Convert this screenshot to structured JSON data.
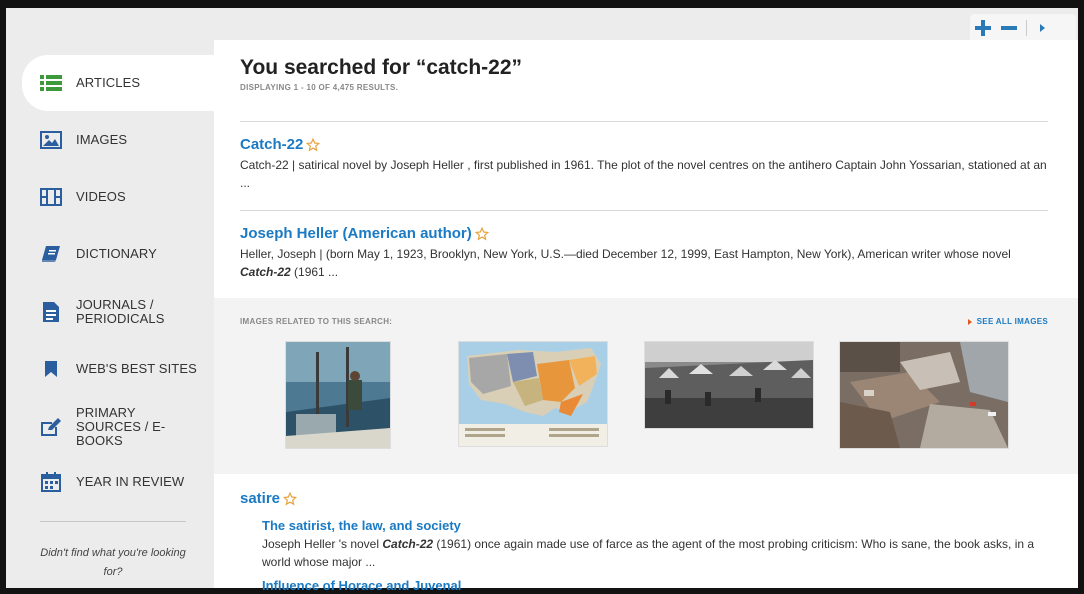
{
  "zoom": {
    "plus_label": "+",
    "minus_label": "−"
  },
  "sidebar": {
    "items": [
      {
        "label": "ARTICLES",
        "icon": "list-icon"
      },
      {
        "label": "IMAGES",
        "icon": "image-icon"
      },
      {
        "label": "VIDEOS",
        "icon": "film-icon"
      },
      {
        "label": "DICTIONARY",
        "icon": "book-icon"
      },
      {
        "label": "JOURNALS / PERIODICALS",
        "icon": "document-icon"
      },
      {
        "label": "WEB'S BEST SITES",
        "icon": "bookmark-icon"
      },
      {
        "label": "PRIMARY SOURCES / E-BOOKS",
        "icon": "edit-icon"
      },
      {
        "label": "YEAR IN REVIEW",
        "icon": "calendar-icon"
      }
    ],
    "help_text": "Didn't find what you're looking for?"
  },
  "search": {
    "title": "You searched for “catch-22”",
    "count": "DISPLAYING 1 - 10 OF 4,475 RESULTS."
  },
  "results": [
    {
      "title": "Catch-22",
      "snippet": "Catch-22  |  satirical novel by Joseph Heller , first published in 1961. The plot of the novel centres on the antihero Captain John Yossarian, stationed at an ..."
    },
    {
      "title": "Joseph Heller (American author)",
      "snippet_pre": "Heller, Joseph  |  (born May 1, 1923, Brooklyn, New York, U.S.—died December 12, 1999, East Hampton, New York), American writer whose novel ",
      "snippet_hl": "Catch-22",
      "snippet_post": "  (1961 ..."
    }
  ],
  "images_section": {
    "label": "IMAGES RELATED TO THIS SEARCH:",
    "see_all": "SEE ALL IMAGES",
    "thumbs": [
      {
        "alt": "fishing boat photo"
      },
      {
        "alt": "United States map"
      },
      {
        "alt": "historical encampment photo"
      },
      {
        "alt": "collapsed buildings photo"
      }
    ]
  },
  "satire": {
    "title": "satire",
    "sub_results": [
      {
        "title": "The satirist, the law, and society",
        "snippet_pre": "Joseph Heller  's novel ",
        "snippet_hl": "Catch-22",
        "snippet_post": "  (1961) once again made use of farce as the agent of the most probing criticism: Who is sane, the book asks, in a world whose major ..."
      },
      {
        "title": "Influence of Horace  and Juvenal"
      }
    ]
  },
  "colors": {
    "link": "#1a7ac4",
    "accent_green": "#3c9a3c",
    "icon_blue": "#2a5e9e",
    "star": "#e6a23c"
  }
}
